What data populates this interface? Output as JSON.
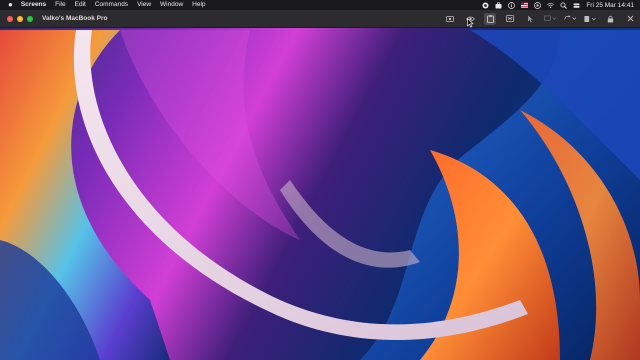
{
  "menubar": {
    "apple_icon": "apple-logo-icon",
    "app_name": "Screens",
    "items": [
      "File",
      "Edit",
      "Commands",
      "View",
      "Window",
      "Help"
    ],
    "datetime": "Fri 25 Mar  14:41",
    "status_icons": [
      "record-icon",
      "briefcase-icon",
      "info-icon",
      "flag-icon",
      "play-icon",
      "wifi-icon",
      "search-icon",
      "toggle-icon"
    ]
  },
  "window": {
    "title": "Valko's MacBook Pro",
    "toolbar_icons": [
      "screenshot-icon",
      "eye-icon",
      "clipboard-icon",
      "keyboard-icon",
      "pointer-icon",
      "display-icon",
      "refresh-icon",
      "document-icon",
      "lock-icon",
      "close-icon"
    ]
  },
  "colors": {
    "menubar_bg": "#1a1a1c",
    "titlebar_bg": "#2c2b2e",
    "close": "#ff5f57",
    "minimize": "#febc2e",
    "maximize": "#28c840"
  }
}
